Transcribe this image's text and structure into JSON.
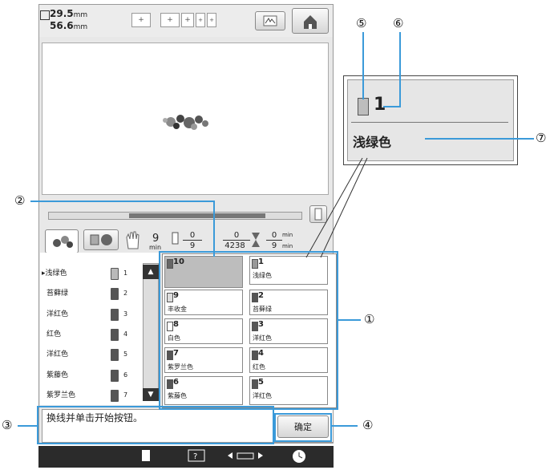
{
  "top": {
    "width": "29.5",
    "height": "56.6",
    "unit": "mm"
  },
  "infobar": {
    "stitches_min": "9",
    "min_label": "min",
    "count_top": "0",
    "count_bottom": "9",
    "stitch_top": "0",
    "stitch_bottom": "4238",
    "time_top": "0",
    "time_bottom": "9",
    "time_unit": "min"
  },
  "color_list": [
    {
      "name": "浅绿色",
      "n": "1",
      "marker": "▸",
      "color": "#b9b9b9"
    },
    {
      "name": "苔藓绿",
      "n": "2",
      "marker": "",
      "color": "#555555"
    },
    {
      "name": "洋红色",
      "n": "3",
      "marker": "",
      "color": "#555555"
    },
    {
      "name": "红色",
      "n": "4",
      "marker": "",
      "color": "#555555"
    },
    {
      "name": "洋红色",
      "n": "5",
      "marker": "",
      "color": "#555555"
    },
    {
      "name": "紫藤色",
      "n": "6",
      "marker": "",
      "color": "#555555"
    },
    {
      "name": "紫罗兰色",
      "n": "7",
      "marker": "",
      "color": "#555555"
    }
  ],
  "needle_grid": [
    {
      "num": "10",
      "name": "",
      "color": "#666666"
    },
    {
      "num": "1",
      "name": "浅绿色",
      "color": "#999999"
    },
    {
      "num": "9",
      "name": "丰收金",
      "color": "#dddddd"
    },
    {
      "num": "2",
      "name": "苔藓绿",
      "color": "#555555"
    },
    {
      "num": "8",
      "name": "白色",
      "color": "#ffffff"
    },
    {
      "num": "3",
      "name": "洋红色",
      "color": "#555555"
    },
    {
      "num": "7",
      "name": "紫罗兰色",
      "color": "#555555"
    },
    {
      "num": "4",
      "name": "红色",
      "color": "#555555"
    },
    {
      "num": "6",
      "name": "紫藤色",
      "color": "#555555"
    },
    {
      "num": "5",
      "name": "洋红色",
      "color": "#555555"
    }
  ],
  "message": "换线并单击开始按钮。",
  "ok_label": "确定",
  "zoom": {
    "num": "1",
    "name": "浅绿色"
  },
  "callouts": {
    "c1": "①",
    "c2": "②",
    "c3": "③",
    "c4": "④",
    "c5": "⑤",
    "c6": "⑥",
    "c7": "⑦"
  },
  "colors": {
    "accent": "#3b9ad9",
    "bottom_bar": "#2b2b2b"
  }
}
